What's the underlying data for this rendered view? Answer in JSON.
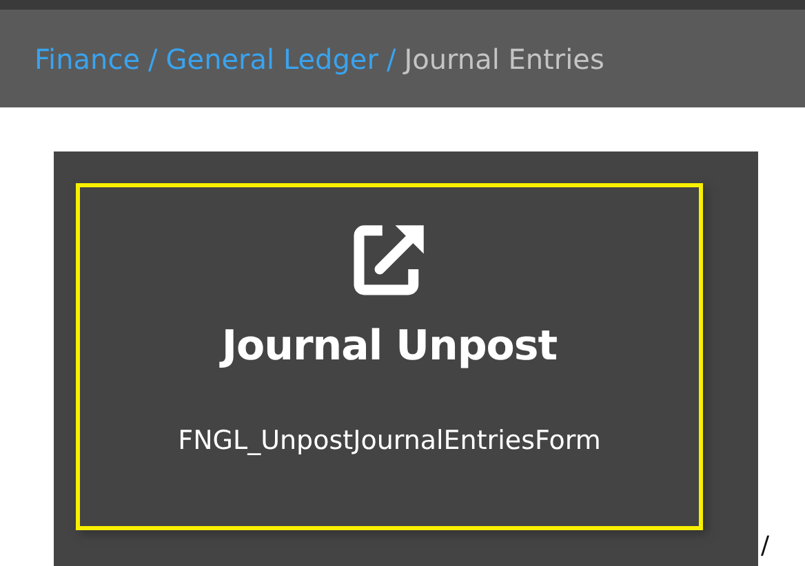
{
  "breadcrumb": {
    "separator": "/",
    "items": [
      {
        "label": "Finance",
        "current": false
      },
      {
        "label": "General Ledger",
        "current": false
      },
      {
        "label": "Journal Entries",
        "current": true
      }
    ]
  },
  "tile": {
    "title": "Journal Unpost",
    "form_name": "FNGL_UnpostJournalEntriesForm",
    "highlighted": true
  },
  "stray_mark": "/"
}
